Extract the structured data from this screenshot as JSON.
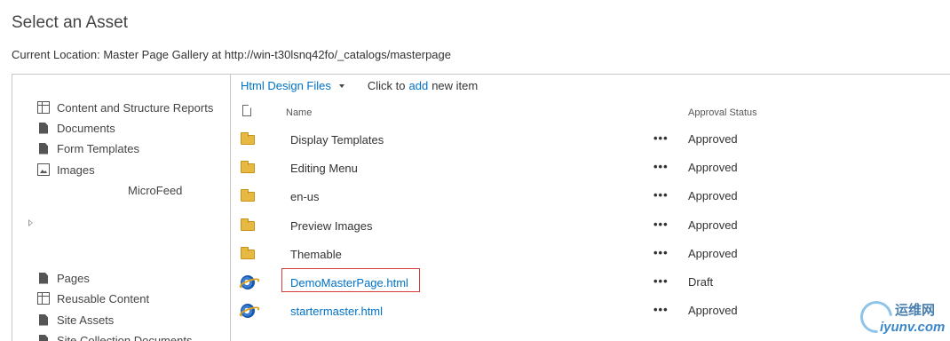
{
  "page": {
    "title": "Select an Asset",
    "location_label": "Current Location: Master Page Gallery at http://win-t30lsnq42fo/_catalogs/masterpage"
  },
  "nav": {
    "top_items": [
      {
        "label": "Content and Structure Reports",
        "icon": "table-icon"
      },
      {
        "label": "Documents",
        "icon": "document-icon"
      },
      {
        "label": "Form Templates",
        "icon": "document-icon"
      },
      {
        "label": "Images",
        "icon": "image-icon"
      }
    ],
    "microfeed": "MicroFeed",
    "bottom_items": [
      {
        "label": "Pages",
        "icon": "document-icon"
      },
      {
        "label": "Reusable Content",
        "icon": "table-icon"
      },
      {
        "label": "Site Assets",
        "icon": "document-icon"
      },
      {
        "label": "Site Collection Documents",
        "icon": "document-icon"
      }
    ]
  },
  "toolbar": {
    "view_name": "Html Design Files",
    "add_prefix": "Click to",
    "add_link": "add",
    "add_suffix": "new item"
  },
  "columns": {
    "name": "Name",
    "status": "Approval Status"
  },
  "rows": [
    {
      "name": "Display Templates",
      "type": "folder",
      "menu": "•••",
      "status": "Approved"
    },
    {
      "name": "Editing Menu",
      "type": "folder",
      "menu": "•••",
      "status": "Approved"
    },
    {
      "name": "en-us",
      "type": "folder",
      "menu": "•••",
      "status": "Approved"
    },
    {
      "name": "Preview Images",
      "type": "folder",
      "menu": "•••",
      "status": "Approved"
    },
    {
      "name": "Themable",
      "type": "folder",
      "menu": "•••",
      "status": "Approved"
    },
    {
      "name": "DemoMasterPage.html",
      "type": "html-file",
      "menu": "•••",
      "status": "Draft",
      "highlighted": true
    },
    {
      "name": "startermaster.html",
      "type": "html-file",
      "menu": "•••",
      "status": "Approved"
    }
  ],
  "watermark": {
    "top": "运维网",
    "bottom": "iyunv.com"
  },
  "colors": {
    "link": "#0072c6",
    "highlight_border": "#d93a3a",
    "folder": "#e8b942"
  }
}
